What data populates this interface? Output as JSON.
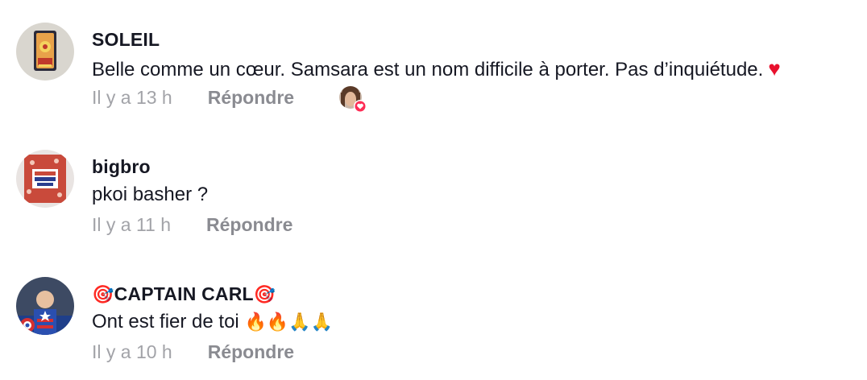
{
  "comments": [
    {
      "username": "SOLEIL",
      "text": "Belle comme un cœur. Samsara est un nom difficile à porter. Pas d’inquiétude.",
      "trailing_emoji": "♥",
      "time": "Il y a 13 h",
      "reply_label": "Répondre",
      "avatar_icon": "tarot-card-avatar",
      "liked_by_creator": true
    },
    {
      "username": "bigbro",
      "text": "pkoi basher ?",
      "time": "Il y a 11 h",
      "reply_label": "Répondre",
      "avatar_icon": "book-cover-avatar"
    },
    {
      "username_prefix_emoji": "🎯",
      "username": "CAPTAIN CARL",
      "username_suffix_emoji": "🎯",
      "text": "Ont est fier de toi",
      "trailing_emojis": "🔥🔥🙏🙏",
      "time": "Il y a 10 h",
      "reply_label": "Répondre",
      "avatar_icon": "captain-costume-avatar"
    }
  ],
  "colors": {
    "primary_text": "#161823",
    "secondary_text": "#a2a3a8",
    "heart": "#e8112d",
    "like_badge": "#fe2c55"
  }
}
